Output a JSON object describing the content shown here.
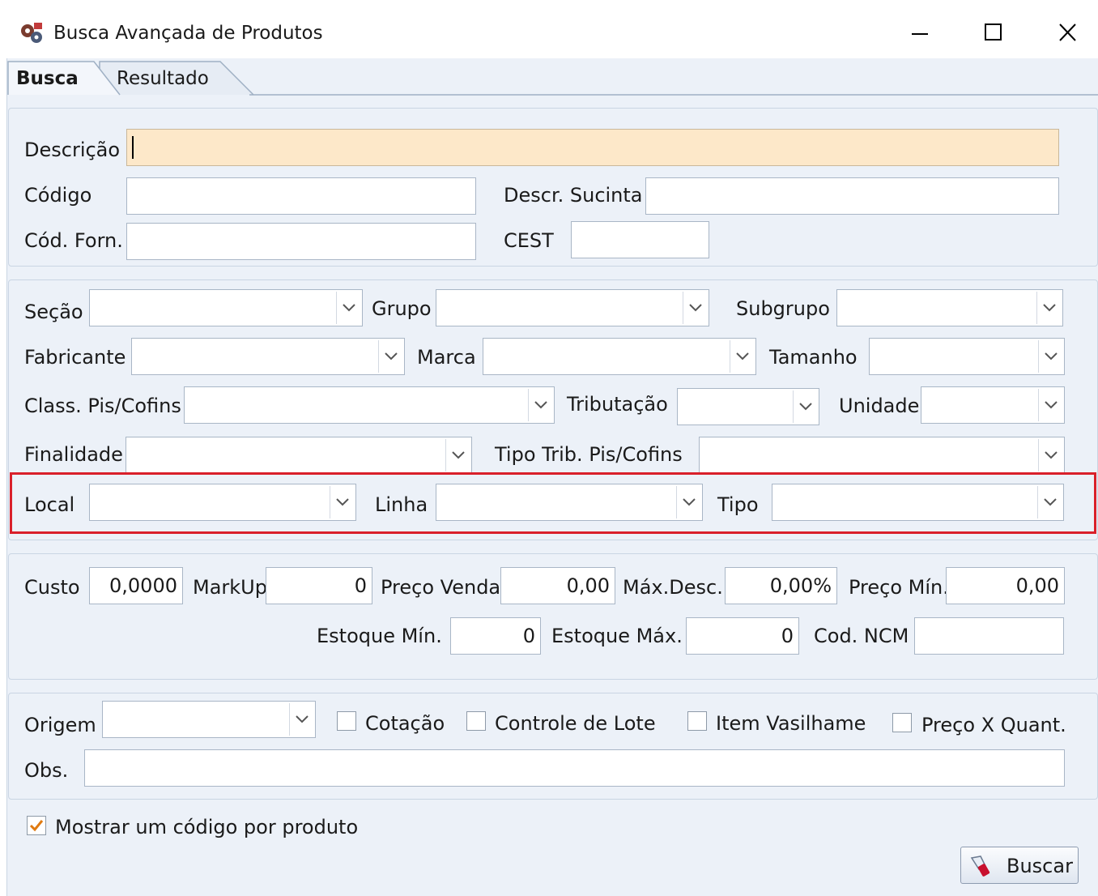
{
  "window": {
    "title": "Busca Avançada de Produtos",
    "app_icon": "gears-icon",
    "minimize_icon": "minimize-icon",
    "maximize_icon": "maximize-icon",
    "close_icon": "close-icon"
  },
  "tabs": [
    {
      "label": "Busca",
      "active": true
    },
    {
      "label": "Resultado",
      "active": false
    }
  ],
  "panel1": {
    "descricao_label": "Descrição",
    "descricao_value": "",
    "codigo_label": "Código",
    "descr_sucinta_label": "Descr. Sucinta",
    "cod_forn_label": "Cód. Forn.",
    "cest_label": "CEST"
  },
  "panel2": {
    "secao_label": "Seção",
    "grupo_label": "Grupo",
    "subgrupo_label": "Subgrupo",
    "fabricante_label": "Fabricante",
    "marca_label": "Marca",
    "tamanho_label": "Tamanho",
    "class_pis_label": "Class. Pis/Cofins",
    "tributacao_label": "Tributação",
    "unidade_label": "Unidade",
    "finalidade_label": "Finalidade",
    "tipo_trib_label": "Tipo Trib. Pis/Cofins",
    "local_label": "Local",
    "linha_label": "Linha",
    "tipo_label": "Tipo",
    "highlight_color": "#d9202a"
  },
  "panel3": {
    "custo_label": "Custo",
    "custo_value": "0,0000",
    "markup_label": "MarkUp",
    "markup_value": "0",
    "preco_venda_label": "Preço Venda",
    "preco_venda_value": "0,00",
    "max_desc_label": "Máx.Desc.",
    "max_desc_value": "0,00%",
    "preco_min_label": "Preço Mín.",
    "preco_min_value": "0,00",
    "estoque_min_label": "Estoque Mín.",
    "estoque_min_value": "0",
    "estoque_max_label": "Estoque Máx.",
    "estoque_max_value": "0",
    "cod_ncm_label": "Cod. NCM"
  },
  "panel4": {
    "origem_label": "Origem",
    "cotacao_label": "Cotação",
    "controle_lote_label": "Controle de Lote",
    "item_vasilhame_label": "Item Vasilhame",
    "preco_quant_label": "Preço X Quant.",
    "obs_label": "Obs."
  },
  "footer": {
    "mostrar_label": "Mostrar um código por produto",
    "mostrar_checked": true,
    "buscar_label": "Buscar",
    "buscar_icon": "flashlight-icon"
  },
  "colors": {
    "focus_field": "#fde8c9",
    "panel_bg": "#ecf1f8",
    "check_accent": "#e07a10"
  }
}
